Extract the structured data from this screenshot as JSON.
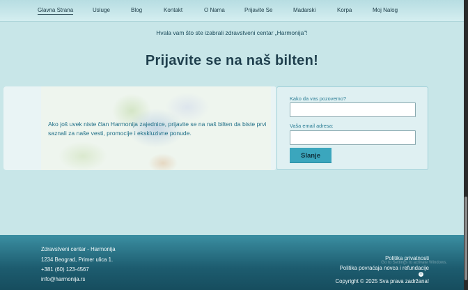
{
  "nav": {
    "items": [
      {
        "label": "Glavna Strana",
        "active": true
      },
      {
        "label": "Usluge"
      },
      {
        "label": "Blog"
      },
      {
        "label": "Kontakt"
      },
      {
        "label": "O Nama"
      },
      {
        "label": "Prijavite Se"
      },
      {
        "label": "Madarski"
      },
      {
        "label": "Korpa"
      },
      {
        "label": "Moj Nalog"
      }
    ]
  },
  "thanks": "Hvala vam što ste izabrali zdravstveni centar „Harmonija\"!",
  "heading": "Prijavite se na naš bilten!",
  "newsletter": {
    "intro": "Ako još uvek niste član Harmonija zajednice, prijavite se na naš bilten da biste prvi saznali za naše vesti, promocije i ekskluzivne ponude.",
    "name_label": "Kako da vas pozovemo?",
    "email_label": "Vaša email adresa:",
    "name_value": "",
    "email_value": "",
    "submit_label": "Slanje"
  },
  "footer": {
    "company": "Zdravstveni centar - Harmonija",
    "address": "1234 Beograd, Primer ulica 1.",
    "phone": "+381 (60) 123-4567",
    "email": "info@harmonija.rs",
    "privacy": "Politika privatnosti",
    "refund": "Politika povraćaja novca i refundacije",
    "copyright": "Copyright © 2025 Sva prava zadržana!",
    "watermark": "Go to Settings to activate Windows.",
    "info_icon": "i"
  },
  "colors": {
    "background": "#c8e6e8",
    "footer": "#1d5c6f",
    "accent": "#3ba6bd",
    "heading": "#1f3f4d"
  }
}
